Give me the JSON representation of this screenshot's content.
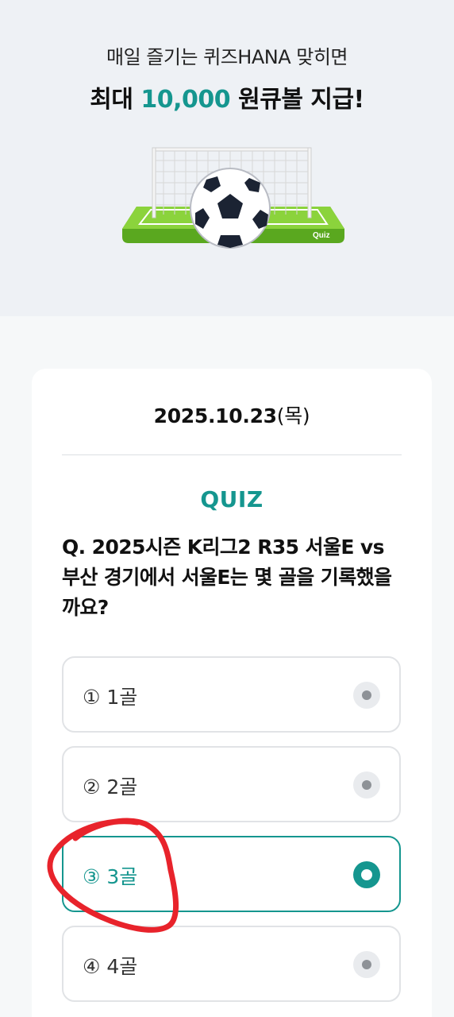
{
  "hero": {
    "subtitle": "매일 즐기는 퀴즈HANA 맞히면",
    "title_prefix": "최대 ",
    "title_amount": "10,000",
    "title_suffix": " 원큐볼 지급!",
    "illustration_label": "Quiz"
  },
  "quiz": {
    "date": "2025.10.23",
    "weekday": "(목)",
    "label": "QUIZ",
    "question": "Q. 2025시즌 K리그2 R35 서울E vs 부산 경기에서 서울E는 몇 골을 기록했을까요?",
    "options": [
      {
        "label": "① 1골",
        "selected": false
      },
      {
        "label": "② 2골",
        "selected": false
      },
      {
        "label": "③ 3골",
        "selected": true
      },
      {
        "label": "④ 4골",
        "selected": false
      }
    ]
  },
  "colors": {
    "accent": "#15968f",
    "annotation": "#e8232b"
  }
}
